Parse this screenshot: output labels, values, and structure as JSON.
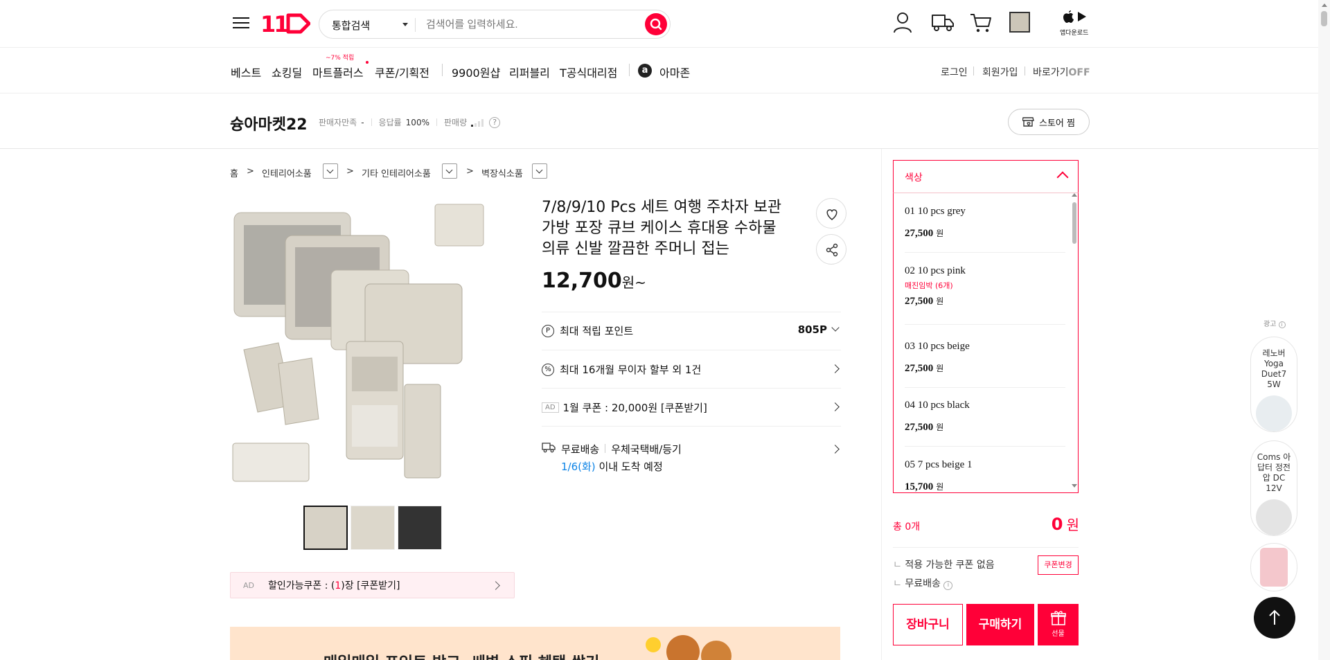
{
  "header": {
    "logo_text": "11",
    "search": {
      "category": "통합검색",
      "placeholder": "검색어를 입력하세요."
    },
    "icons": [
      "user-icon",
      "delivery-truck-icon",
      "cart-icon",
      "recent-item-thumb",
      "app-store-icon"
    ],
    "app_download": "앱다운로드"
  },
  "nav": {
    "items": [
      "베스트",
      "쇼킹딜",
      "마트플러스",
      "쿠폰/기획전",
      "9900원샵",
      "리퍼블리",
      "T공식대리점",
      "아마존"
    ],
    "mart_badge": "~7% 적립",
    "amazon_logo": "a",
    "right": {
      "login": "로그인",
      "signup": "회원가입",
      "shortcut": "바로가기",
      "shortcut_state": "OFF"
    }
  },
  "store": {
    "name": "슝아마켓22",
    "satisfaction_label": "판매자만족",
    "satisfaction_value": "-",
    "response_label": "응답률",
    "response_value": "100%",
    "sales_label": "판매량",
    "help": "?",
    "follow_button": "스토어 찜"
  },
  "breadcrumb": [
    "홈",
    "인테리어소품",
    "기타 인테리어소품",
    "벽장식소품"
  ],
  "product": {
    "title_lines": [
      "7/8/9/10 Pcs 세트 여행 주차자 보관",
      "가방 포장 큐브 케이스 휴대용 수하물",
      "의류 신발 깔끔한 주머니 접는"
    ],
    "price": "12,700",
    "price_unit": "원~",
    "points_label": "최대 적립 포인트",
    "points_value": "805P",
    "points_icon": "P",
    "installment": "최대 16개월 무이자 할부 외 1건",
    "installment_icon": "%",
    "ad_badge": "AD",
    "coupon": "1월 쿠폰 : 20,000원 [쿠폰받기]",
    "shipping_label": "무료배송",
    "shipping_method": "우체국택배/등기",
    "arrival_date": "1/6(화)",
    "arrival_suffix": "이내 도착 예정",
    "discount_ad": "AD",
    "discount_text_pre": "할인가능쿠폰 : (",
    "discount_count": "1",
    "discount_text_post": ")장 [쿠폰받기]",
    "banner_text": "매일매일 포인트 받고, 쌔벽 쇼핑 혜택 쌓기"
  },
  "options": {
    "header": "색상",
    "items": [
      {
        "name": "01 10 pcs grey",
        "price": "27,500",
        "unit": "원",
        "warn": ""
      },
      {
        "name": "02 10 pcs pink",
        "price": "27,500",
        "unit": "원",
        "warn": "매진임박 (6개)"
      },
      {
        "name": "03 10 pcs beige",
        "price": "27,500",
        "unit": "원",
        "warn": ""
      },
      {
        "name": "04 10 pcs black",
        "price": "27,500",
        "unit": "원",
        "warn": ""
      },
      {
        "name": "05 7 pcs beige 1",
        "price": "15,700",
        "unit": "원",
        "warn": ""
      }
    ],
    "total_label": "총 0개",
    "total_value": "0",
    "total_unit": "원",
    "coupon_none": "적용 가능한 쿠폰 없음",
    "coupon_change": "쿠폰변경",
    "free_shipping": "무료배송",
    "cart_button": "장바구니",
    "buy_button": "구매하기",
    "gift_button": "선물"
  },
  "ads": {
    "label": "광고",
    "cards": [
      {
        "text": "레노버 Yoga Duet7 5W"
      },
      {
        "text": "Coms 아답터 정전압 DC 12V"
      },
      {
        "text": ""
      }
    ]
  }
}
